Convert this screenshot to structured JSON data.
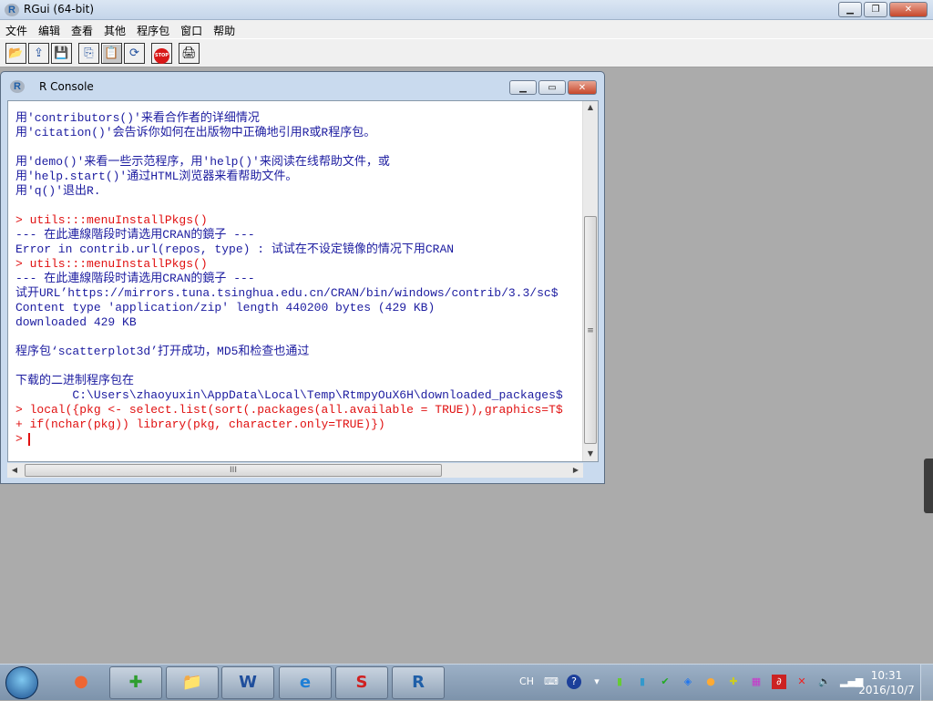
{
  "app": {
    "title": "RGui (64-bit)",
    "logo": "R"
  },
  "menu": [
    "文件",
    "编辑",
    "查看",
    "其他",
    "程序包",
    "窗口",
    "帮助"
  ],
  "toolbar": [
    {
      "icon": "open-folder-icon",
      "glyph": "📂"
    },
    {
      "icon": "load-workspace-icon",
      "glyph": "⇪"
    },
    {
      "icon": "save-icon",
      "glyph": "💾"
    },
    {
      "icon": "copy-icon",
      "glyph": "⎘"
    },
    {
      "icon": "paste-icon",
      "glyph": "📋"
    },
    {
      "icon": "refresh-icon",
      "glyph": "⟳"
    },
    {
      "icon": "stop-icon",
      "glyph": "STOP"
    },
    {
      "icon": "print-icon",
      "glyph": "🖨"
    }
  ],
  "console": {
    "title": "R Console",
    "lines": [
      {
        "t": "用'contributors()'来看合作者的详细情况",
        "c": "out"
      },
      {
        "t": "用'citation()'会告诉你如何在出版物中正确地引用R或R程序包。",
        "c": "out"
      },
      {
        "t": "用'demo()'来看一些示范程序，用'help()'来阅读在线帮助文件，或",
        "c": "out"
      },
      {
        "t": "用'help.start()'通过HTML浏览器来看帮助文件。",
        "c": "out"
      },
      {
        "t": "用'q()'退出R.",
        "c": "out"
      },
      {
        "t": "> utils:::menuInstallPkgs()",
        "c": "cmd"
      },
      {
        "t": "--- 在此連線階段时请选用CRAN的鏡子 ---",
        "c": "out"
      },
      {
        "t": "Error in contrib.url(repos, type) : 试试在不设定镜像的情况下用CRAN",
        "c": "out"
      },
      {
        "t": "> utils:::menuInstallPkgs()",
        "c": "cmd"
      },
      {
        "t": "--- 在此連線階段时请选用CRAN的鏡子 ---",
        "c": "out"
      },
      {
        "t": "试开URL’https://mirrors.tuna.tsinghua.edu.cn/CRAN/bin/windows/contrib/3.3/sc$",
        "c": "out"
      },
      {
        "t": "Content type 'application/zip' length 440200 bytes (429 KB)",
        "c": "out"
      },
      {
        "t": "downloaded 429 KB",
        "c": "out"
      },
      {
        "t": "程序包‘scatterplot3d’打开成功，MD5和检查也通过",
        "c": "out"
      },
      {
        "t": "下载的二进制程序包在",
        "c": "out"
      },
      {
        "t": "        C:\\Users\\zhaoyuxin\\AppData\\Local\\Temp\\RtmpyOuX6H\\downloaded_packages$",
        "c": "out"
      },
      {
        "t": "> local({pkg <- select.list(sort(.packages(all.available = TRUE)),graphics=T$",
        "c": "cmd"
      },
      {
        "t": "+ if(nchar(pkg)) library(pkg, character.only=TRUE)})",
        "c": "cmd"
      },
      {
        "t": ">",
        "c": "cmd"
      }
    ]
  },
  "taskbar": {
    "apps": [
      {
        "name": "360-app",
        "glyph": "✚",
        "color": "#2e9e2e"
      },
      {
        "name": "explorer",
        "glyph": "📁",
        "color": "#c9a43a"
      },
      {
        "name": "word",
        "glyph": "W",
        "color": "#1f4e9c"
      },
      {
        "name": "ie",
        "glyph": "e",
        "color": "#1e7fd6"
      },
      {
        "name": "sogou",
        "glyph": "S",
        "color": "#d02020"
      },
      {
        "name": "r-gui",
        "glyph": "R",
        "color": "#1f5fa8"
      }
    ],
    "lang": "CH",
    "time": "10:31",
    "date": "2016/10/7"
  }
}
